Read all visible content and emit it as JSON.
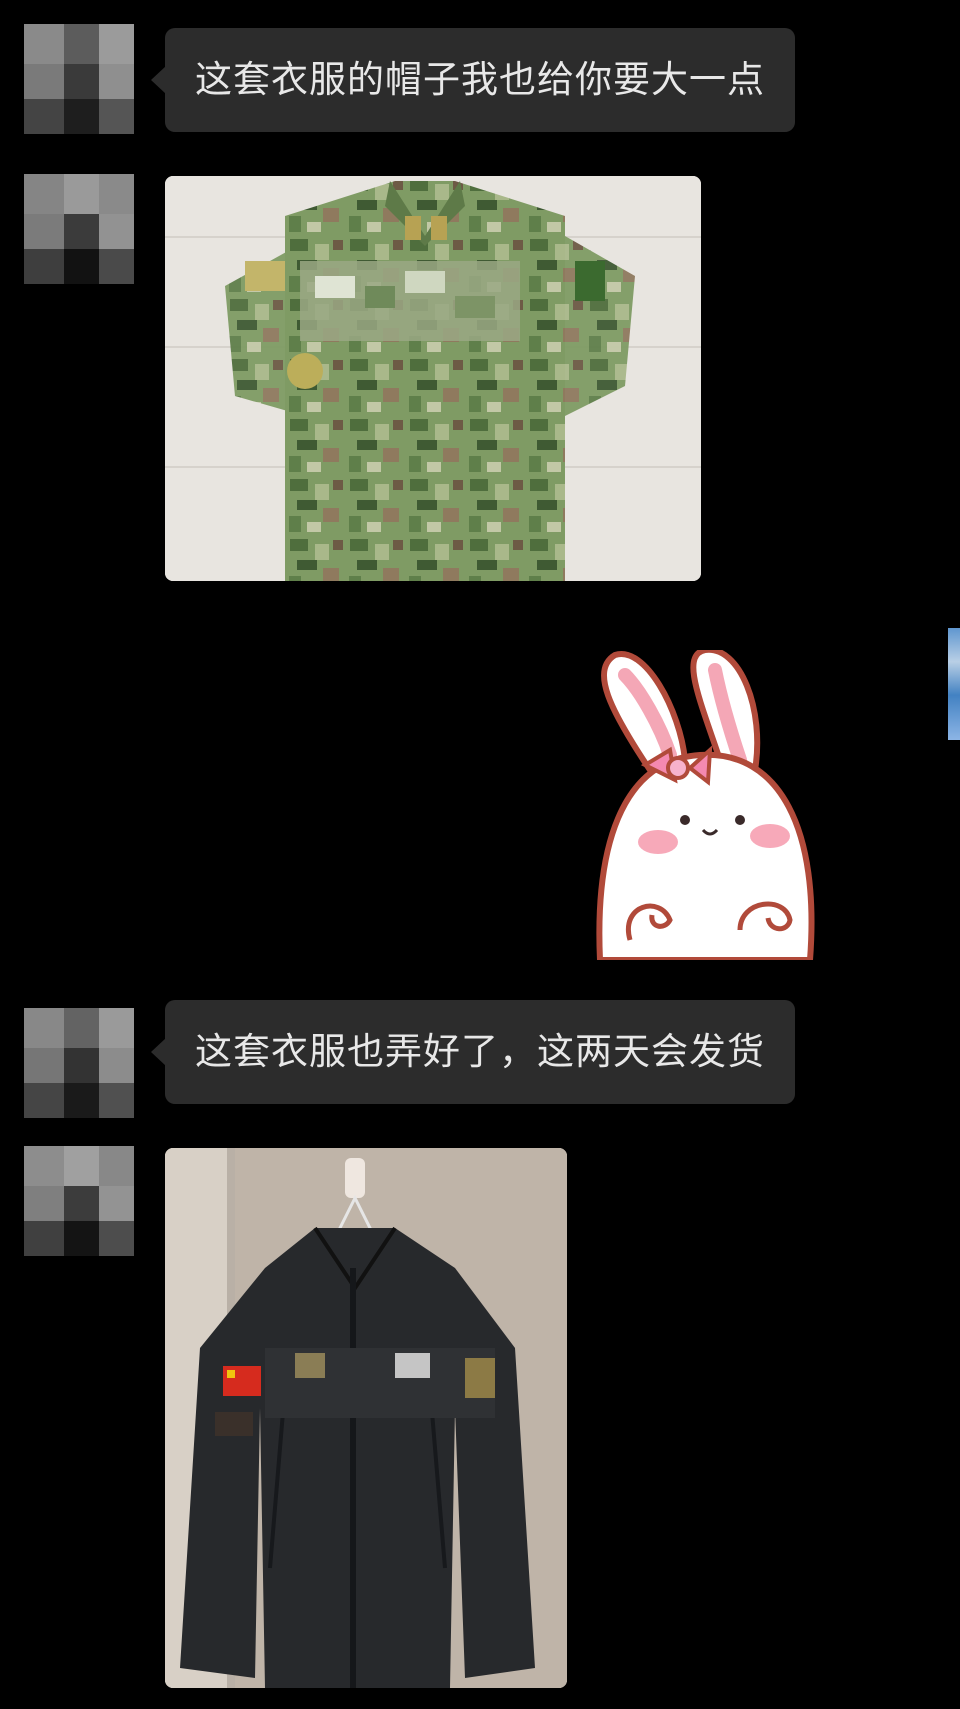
{
  "chat": {
    "messages": [
      {
        "type": "text",
        "sender": "contact",
        "text": "这套衣服的帽子我也给你要大一点"
      },
      {
        "type": "image",
        "sender": "contact",
        "content": "camouflage-uniform-photo"
      },
      {
        "type": "sticker",
        "sender": "me",
        "content": "bunny-sticker"
      },
      {
        "type": "text",
        "sender": "contact",
        "text": "这套衣服也弄好了，这两天会发货"
      },
      {
        "type": "image",
        "sender": "contact",
        "content": "black-jacket-photo"
      }
    ]
  },
  "colors": {
    "background": "#000000",
    "bubble": "#2c2c2c",
    "bubble_text": "#e8e8e8"
  }
}
